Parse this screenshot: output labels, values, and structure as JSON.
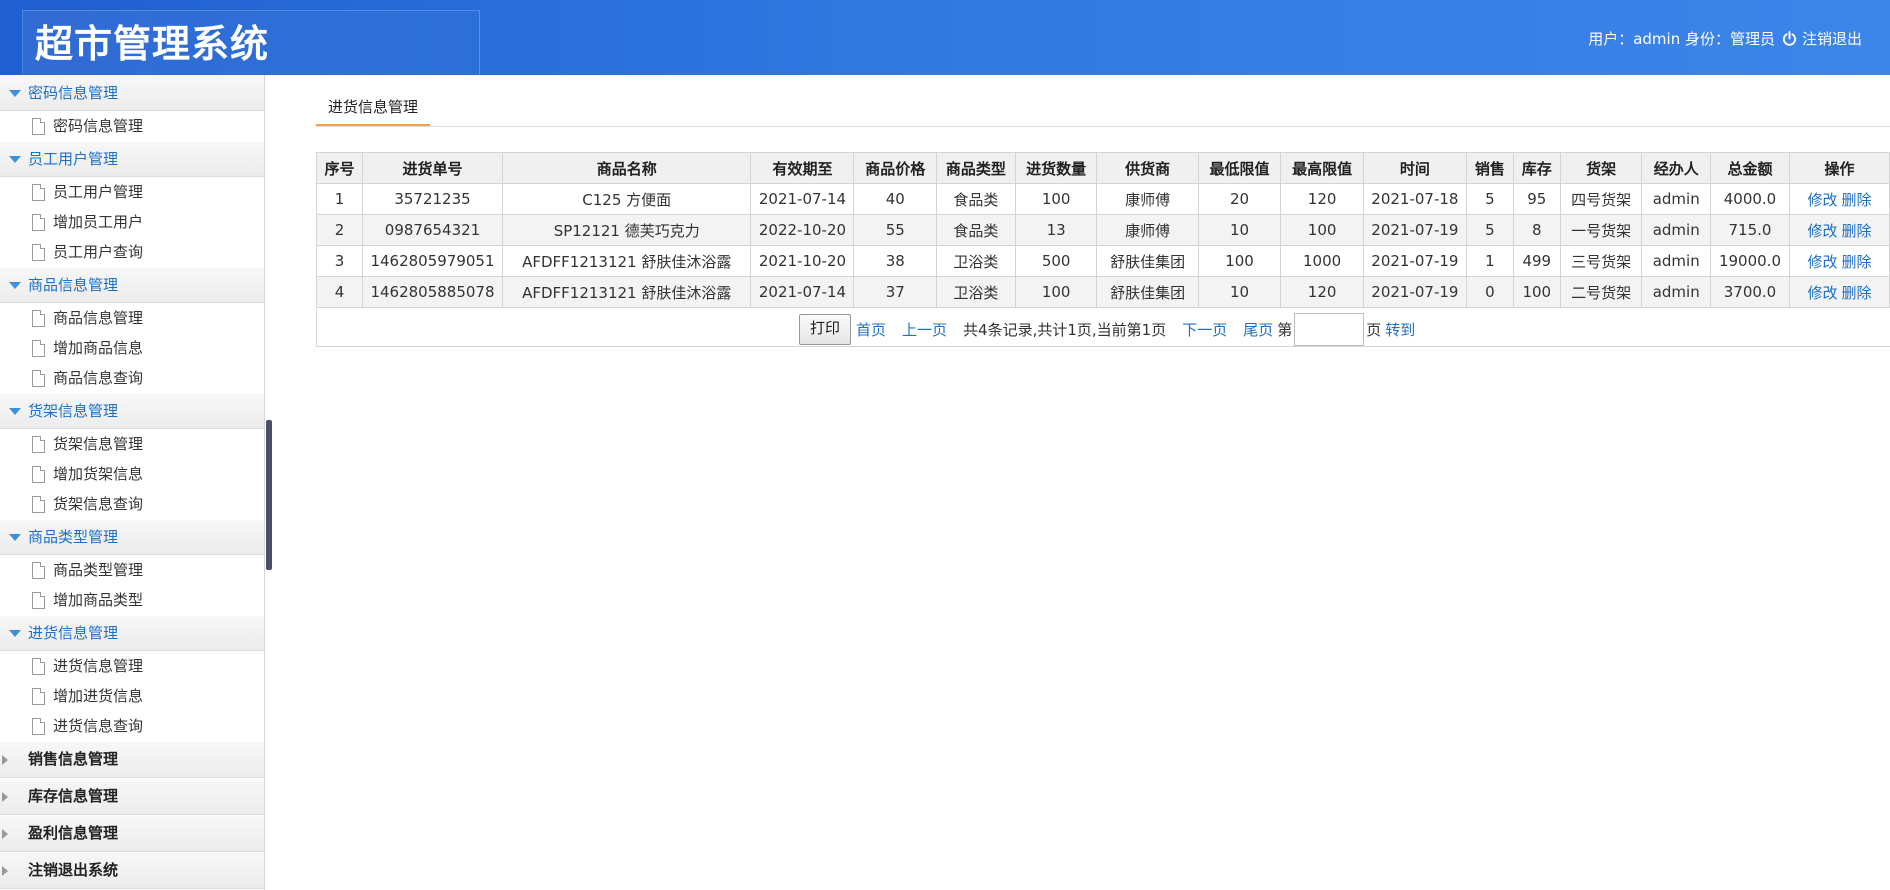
{
  "header": {
    "title": "超市管理系统",
    "user_info": "用户：admin 身份：管理员",
    "logout_label": "注销退出"
  },
  "sidebar": {
    "groups": [
      {
        "title": "密码信息管理",
        "open": true,
        "items": [
          "密码信息管理"
        ]
      },
      {
        "title": "员工用户管理",
        "open": true,
        "items": [
          "员工用户管理",
          "增加员工用户",
          "员工用户查询"
        ]
      },
      {
        "title": "商品信息管理",
        "open": true,
        "items": [
          "商品信息管理",
          "增加商品信息",
          "商品信息查询"
        ]
      },
      {
        "title": "货架信息管理",
        "open": true,
        "items": [
          "货架信息管理",
          "增加货架信息",
          "货架信息查询"
        ]
      },
      {
        "title": "商品类型管理",
        "open": true,
        "items": [
          "商品类型管理",
          "增加商品类型"
        ]
      },
      {
        "title": "进货信息管理",
        "open": true,
        "items": [
          "进货信息管理",
          "增加进货信息",
          "进货信息查询"
        ]
      },
      {
        "title": "销售信息管理",
        "open": false,
        "items": []
      },
      {
        "title": "库存信息管理",
        "open": false,
        "items": []
      },
      {
        "title": "盈利信息管理",
        "open": false,
        "items": []
      },
      {
        "title": "注销退出系统",
        "open": false,
        "items": []
      }
    ]
  },
  "main": {
    "tab_label": "进货信息管理",
    "table": {
      "columns": [
        "序号",
        "进货单号",
        "商品名称",
        "有效期至",
        "商品价格",
        "商品类型",
        "进货数量",
        "供货商",
        "最低限值",
        "最高限值",
        "时间",
        "销售",
        "库存",
        "货架",
        "经办人",
        "总金额",
        "操作"
      ],
      "rows": [
        [
          "1",
          "35721235",
          "C125 方便面",
          "2021-07-14",
          "40",
          "食品类",
          "100",
          "康师傅",
          "20",
          "120",
          "2021-07-18",
          "5",
          "95",
          "四号货架",
          "admin",
          "4000.0"
        ],
        [
          "2",
          "0987654321",
          "SP12121 德芙巧克力",
          "2022-10-20",
          "55",
          "食品类",
          "13",
          "康师傅",
          "10",
          "100",
          "2021-07-19",
          "5",
          "8",
          "一号货架",
          "admin",
          "715.0"
        ],
        [
          "3",
          "1462805979051",
          "AFDFF1213121 舒肤佳沐浴露",
          "2021-10-20",
          "38",
          "卫浴类",
          "500",
          "舒肤佳集团",
          "100",
          "1000",
          "2021-07-19",
          "1",
          "499",
          "三号货架",
          "admin",
          "19000.0"
        ],
        [
          "4",
          "1462805885078",
          "AFDFF1213121 舒肤佳沐浴露",
          "2021-07-14",
          "37",
          "卫浴类",
          "100",
          "舒肤佳集团",
          "10",
          "120",
          "2021-07-19",
          "0",
          "100",
          "二号货架",
          "admin",
          "3700.0"
        ]
      ],
      "edit_label": "修改",
      "delete_label": "删除"
    },
    "pager": {
      "print_label": "打印",
      "first": "首页",
      "prev": "上一页",
      "summary": "共4条记录,共计1页,当前第1页",
      "next": "下一页",
      "last": "尾页",
      "page_prefix": "第",
      "page_suffix": "页",
      "goto": "转到",
      "page_input_value": ""
    }
  }
}
